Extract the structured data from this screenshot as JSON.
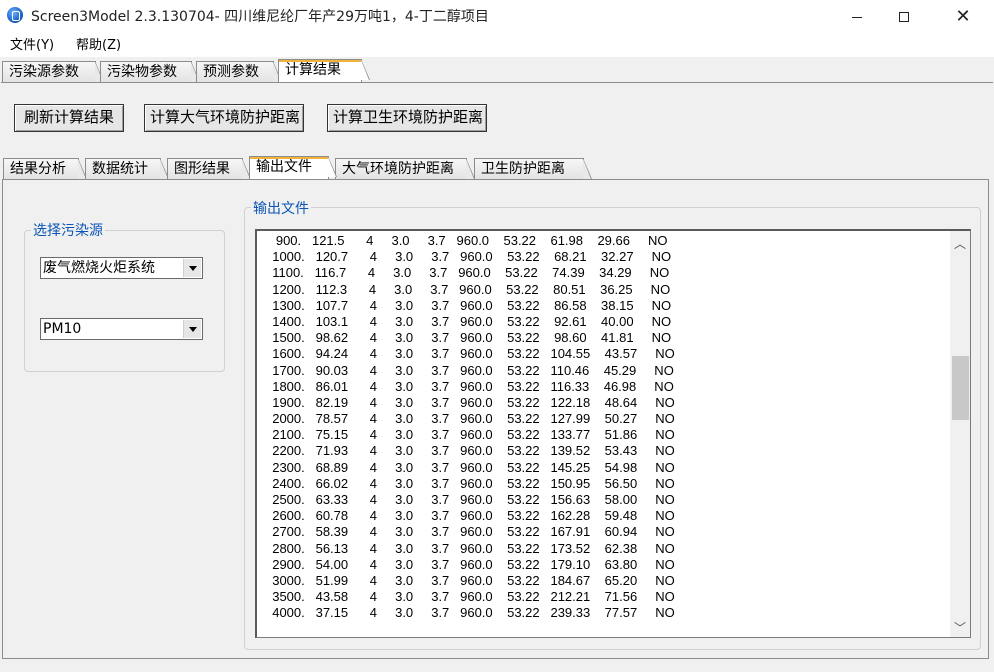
{
  "window": {
    "title": "Screen3Model 2.3.130704- 四川维尼纶厂年产29万吨1，4-丁二醇项目",
    "minimize_label": "—",
    "maximize_label": "☐",
    "close_label": "✕"
  },
  "menu": {
    "items": [
      "文件(Y)",
      "帮助(Z)"
    ]
  },
  "top_tabs": [
    "污染源参数",
    "污染物参数",
    "预测参数",
    "计算结果"
  ],
  "top_tabs_active": "计算结果",
  "toolbar": {
    "refresh_label": "刷新计算结果",
    "air_distance_label": "计算大气环境防护距离",
    "sanitary_distance_label": "计算卫生环境防护距离"
  },
  "sub_tabs": [
    "结果分析",
    "数据统计",
    "图形结果",
    "输出文件",
    "大气环境防护距离",
    "卫生防护距离"
  ],
  "sub_tabs_active": "输出文件",
  "source_group": {
    "label": "选择污染源",
    "source_value": "废气燃烧火炬系统",
    "pollutant_value": "PM10"
  },
  "output_group": {
    "label": "输出文件"
  },
  "output_lines": [
    "   900.   121.5      4     3.0     3.7   960.0    53.22    61.98    29.66     NO",
    "  1000.   120.7      4     3.0     3.7   960.0    53.22    68.21    32.27     NO",
    "  1100.   116.7      4     3.0     3.7   960.0    53.22    74.39    34.29     NO",
    "  1200.   112.3      4     3.0     3.7   960.0    53.22    80.51    36.25     NO",
    "  1300.   107.7      4     3.0     3.7   960.0    53.22    86.58    38.15     NO",
    "  1400.   103.1      4     3.0     3.7   960.0    53.22    92.61    40.00     NO",
    "  1500.   98.62      4     3.0     3.7   960.0    53.22    98.60    41.81     NO",
    "  1600.   94.24      4     3.0     3.7   960.0    53.22   104.55    43.57     NO",
    "  1700.   90.03      4     3.0     3.7   960.0    53.22   110.46    45.29     NO",
    "  1800.   86.01      4     3.0     3.7   960.0    53.22   116.33    46.98     NO",
    "  1900.   82.19      4     3.0     3.7   960.0    53.22   122.18    48.64     NO",
    "  2000.   78.57      4     3.0     3.7   960.0    53.22   127.99    50.27     NO",
    "  2100.   75.15      4     3.0     3.7   960.0    53.22   133.77    51.86     NO",
    "  2200.   71.93      4     3.0     3.7   960.0    53.22   139.52    53.43     NO",
    "  2300.   68.89      4     3.0     3.7   960.0    53.22   145.25    54.98     NO",
    "  2400.   66.02      4     3.0     3.7   960.0    53.22   150.95    56.50     NO",
    "  2500.   63.33      4     3.0     3.7   960.0    53.22   156.63    58.00     NO",
    "  2600.   60.78      4     3.0     3.7   960.0    53.22   162.28    59.48     NO",
    "  2700.   58.39      4     3.0     3.7   960.0    53.22   167.91    60.94     NO",
    "  2800.   56.13      4     3.0     3.7   960.0    53.22   173.52    62.38     NO",
    "  2900.   54.00      4     3.0     3.7   960.0    53.22   179.10    63.80     NO",
    "  3000.   51.99      4     3.0     3.7   960.0    53.22   184.67    65.20     NO",
    "  3500.   43.58      4     3.0     3.7   960.0    53.22   212.21    71.56     NO",
    "  4000.   37.15      4     3.0     3.7   960.0    53.22   239.33    77.57     NO"
  ],
  "scrollbar": {
    "up_glyph": "︿",
    "down_glyph": "﹀",
    "position_fraction": 0.35
  },
  "colors": {
    "accent": "#f2b33d",
    "group_label": "#0a55b5",
    "panel_bg": "#f0f0f0"
  }
}
